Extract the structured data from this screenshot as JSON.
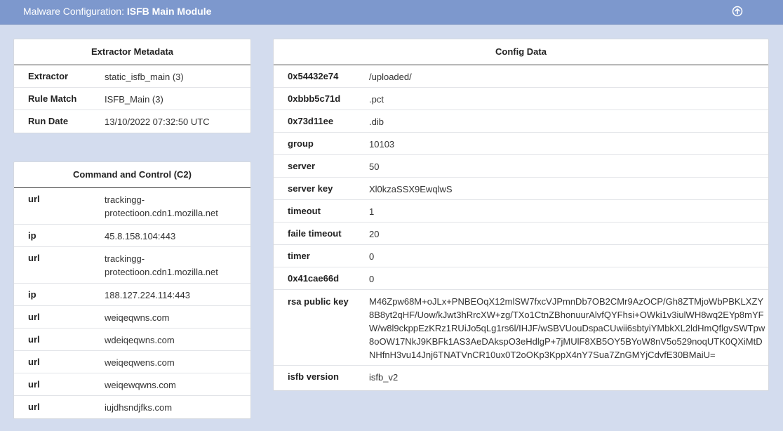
{
  "header": {
    "prefix": "Malware Configuration: ",
    "title": "ISFB Main Module",
    "icon": "arrow-up-circle-icon"
  },
  "extractor_metadata": {
    "title": "Extractor Metadata",
    "rows": [
      {
        "key": "Extractor",
        "value": "static_isfb_main (3)"
      },
      {
        "key": "Rule Match",
        "value": "ISFB_Main (3)"
      },
      {
        "key": "Run Date",
        "value": "13/10/2022 07:32:50 UTC"
      }
    ]
  },
  "c2": {
    "title": "Command and Control (C2)",
    "rows": [
      {
        "key": "url",
        "value": "trackingg-protectioon.cdn1.mozilla.net"
      },
      {
        "key": "ip",
        "value": "45.8.158.104:443"
      },
      {
        "key": "url",
        "value": "trackingg-protectioon.cdn1.mozilla.net"
      },
      {
        "key": "ip",
        "value": "188.127.224.114:443"
      },
      {
        "key": "url",
        "value": "weiqeqwns.com"
      },
      {
        "key": "url",
        "value": "wdeiqeqwns.com"
      },
      {
        "key": "url",
        "value": "weiqeqwens.com"
      },
      {
        "key": "url",
        "value": "weiqewqwns.com"
      },
      {
        "key": "url",
        "value": "iujdhsndjfks.com"
      }
    ]
  },
  "config": {
    "title": "Config Data",
    "rows": [
      {
        "key": "0x54432e74",
        "value": "/uploaded/"
      },
      {
        "key": "0xbbb5c71d",
        "value": ".pct"
      },
      {
        "key": "0x73d11ee",
        "value": ".dib"
      },
      {
        "key": "group",
        "value": "10103"
      },
      {
        "key": "server",
        "value": "50"
      },
      {
        "key": "server key",
        "value": "Xl0kzaSSX9EwqlwS"
      },
      {
        "key": "timeout",
        "value": "1"
      },
      {
        "key": "faile timeout",
        "value": "20"
      },
      {
        "key": "timer",
        "value": "0"
      },
      {
        "key": "0x41cae66d",
        "value": "0"
      },
      {
        "key": "rsa public key",
        "value": "M46Zpw68M+oJLx+PNBEOqX12mlSW7fxcVJPmnDb7OB2CMr9AzOCP/Gh8ZTMjoWbPBKLXZY8B8yt2qHF/Uow/kJwt3hRrcXW+zg/TXo1CtnZBhonuurAlvfQYFhsi+OWki1v3iulWH8wq2EYp8mYFW/w8l9ckppEzKRz1RUiJo5qLg1rs6l/IHJF/wSBVUouDspaCUwii6sbtyiYMbkXL2ldHmQflgvSWTpw8oOW17NkJ9KBFk1AS3AeDAkspO3eHdlgP+7jMUlF8XB5OY5BYoW8nV5o529noqUTK0QXiMtDNHfnH3vu14Jnj6TNATVnCR10ux0T2oOKp3KppX4nY7Sua7ZnGMYjCdvfE30BMaiU="
      },
      {
        "key": "isfb version",
        "value": "isfb_v2"
      }
    ]
  }
}
